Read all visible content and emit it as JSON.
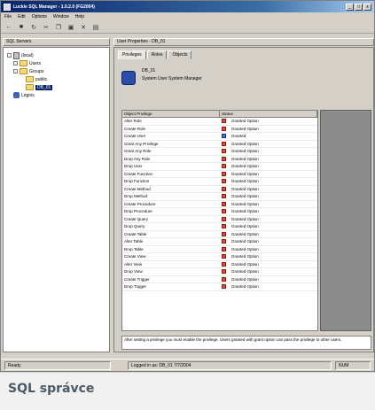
{
  "window": {
    "title": "Luckie SQL Manager - 1.0.2.0 (FG2004)",
    "buttons": [
      "_",
      "□",
      "x"
    ]
  },
  "menubar": [
    "File",
    "Edit",
    "Options",
    "Window",
    "Help"
  ],
  "toolbar": {
    "icons": [
      "back-icon",
      "forward-icon",
      "refresh-icon",
      "cut-icon",
      "copy-icon",
      "paste-icon",
      "delete-icon",
      "properties-icon"
    ]
  },
  "left_pane": {
    "header": "SQL Servers",
    "tree": [
      {
        "label": "(local)",
        "kind": "server",
        "level": 0
      },
      {
        "label": "Users",
        "kind": "folder",
        "level": 1
      },
      {
        "label": "Groups",
        "kind": "folder",
        "level": 1
      },
      {
        "label": "public",
        "kind": "folder",
        "level": 2
      },
      {
        "label": "DB_01",
        "kind": "folder",
        "level": 2,
        "selected": true
      },
      {
        "label": "Logins",
        "kind": "db",
        "level": 1
      }
    ]
  },
  "right_pane": {
    "header": "User Properties - DB_01",
    "tabs": [
      "Privileges",
      "Roles",
      "Objects"
    ],
    "info": {
      "line1": "DB_01",
      "line2": "System User System Manager"
    },
    "grid": {
      "columns": [
        "Object Privilege",
        "Status"
      ],
      "rows": [
        [
          "Alter Role",
          "on",
          "Granted Option"
        ],
        [
          "Create Role",
          "on",
          "Granted Option"
        ],
        [
          "Create User",
          "alt",
          "Granted"
        ],
        [
          "Grant Any Privilege",
          "on",
          "Granted Option"
        ],
        [
          "Grant Any Role",
          "on",
          "Granted Option"
        ],
        [
          "Drop Any Role",
          "on",
          "Granted Option"
        ],
        [
          "Drop User",
          "on",
          "Granted Option"
        ],
        [
          "Create Function",
          "on",
          "Granted Option"
        ],
        [
          "Drop Function",
          "on",
          "Granted Option"
        ],
        [
          "Create Method",
          "on",
          "Granted Option"
        ],
        [
          "Drop Method",
          "on",
          "Granted Option"
        ],
        [
          "Create Procedure",
          "on",
          "Granted Option"
        ],
        [
          "Drop Procedure",
          "on",
          "Granted Option"
        ],
        [
          "Create Query",
          "on",
          "Granted Option"
        ],
        [
          "Drop Query",
          "on",
          "Granted Option"
        ],
        [
          "Create Table",
          "on",
          "Granted Option"
        ],
        [
          "Alter Table",
          "on",
          "Granted Option"
        ],
        [
          "Drop Table",
          "on",
          "Granted Option"
        ],
        [
          "Create View",
          "on",
          "Granted Option"
        ],
        [
          "Alter View",
          "on",
          "Granted Option"
        ],
        [
          "Drop View",
          "on",
          "Granted Option"
        ],
        [
          "Create Trigger",
          "on",
          "Granted Option"
        ],
        [
          "Drop Trigger",
          "on",
          "Granted Option"
        ]
      ]
    },
    "description": "After setting a privilege you must enable the privilege. Users granted with grant option can pass the privilege to other users."
  },
  "statusbar": {
    "left": "Ready",
    "middle": "Logged in as: DB_01 7/7/2004",
    "right": "NUM"
  },
  "caption": "SQL správce"
}
